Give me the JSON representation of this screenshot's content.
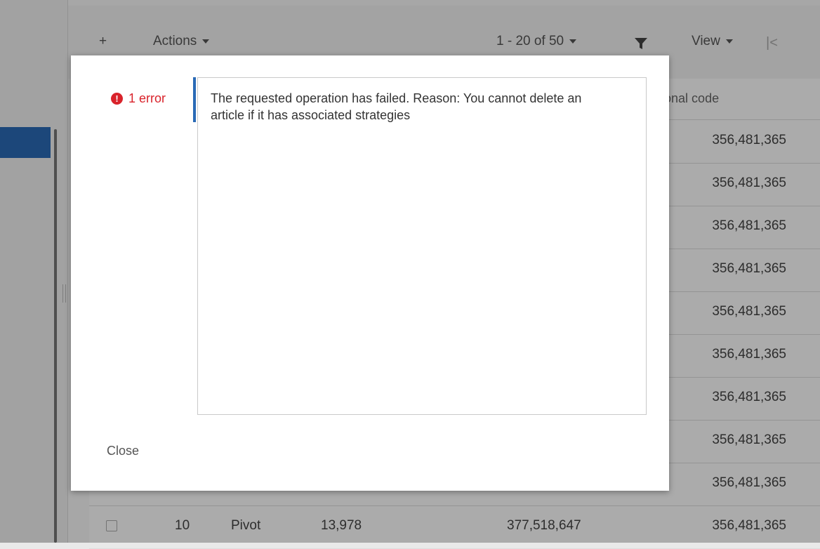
{
  "toolbar": {
    "add_label": "+",
    "actions_label": "Actions",
    "pagination_label": "1 - 20 of 50",
    "view_label": "View",
    "first_page_label": "|<"
  },
  "grid": {
    "visible_header": "national code",
    "rows": [
      {
        "code": "356,481,365"
      },
      {
        "code": "356,481,365"
      },
      {
        "code": "356,481,365"
      },
      {
        "code": "356,481,365"
      },
      {
        "code": "356,481,365"
      },
      {
        "code": "356,481,365"
      },
      {
        "code": "356,481,365"
      },
      {
        "code": "356,481,365"
      },
      {
        "code": "356,481,365"
      },
      {
        "number": "10",
        "name": "Pivot",
        "quantity": "13,978",
        "id": "377,518,647",
        "code": "356,481,365"
      }
    ]
  },
  "modal": {
    "error_icon": "!",
    "error_count": "1 error",
    "message": "The requested operation has failed. Reason: You cannot delete an article if it has associated strategies",
    "close_label": "Close"
  },
  "colors": {
    "error": "#d9232b",
    "accent": "#2a6ab6"
  }
}
